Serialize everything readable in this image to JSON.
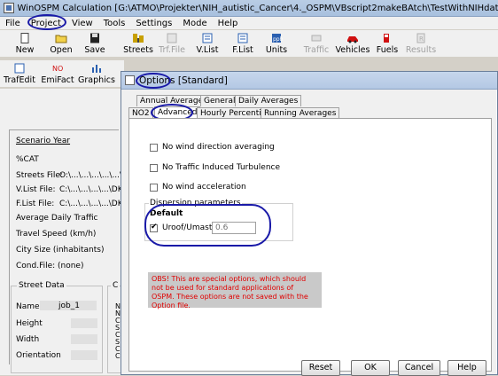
{
  "window": {
    "title": "WinOSPM Calculation [G:\\ATMO\\Projekter\\NIH_autistic_Cancer\\4._OSPM\\VBscript2makeBAtch\\TestWithNIHdata\\M..."
  },
  "menu": [
    "File",
    "Project",
    "View",
    "Tools",
    "Settings",
    "Mode",
    "Help"
  ],
  "toolbar": {
    "new": "New",
    "open": "Open",
    "save": "Save",
    "streets": "Streets",
    "trf_file": "Trf.File",
    "vlist": "V.List",
    "flist": "F.List",
    "units": "Units",
    "traffic": "Traffic",
    "vehicles": "Vehicles",
    "fuels": "Fuels",
    "results": "Results"
  },
  "toolbar2": {
    "trafedit": "TrafEdit",
    "emifact": "EmiFact",
    "graphics": "Graphics"
  },
  "left_panel": {
    "scenario_year": "Scenario Year",
    "cat": "%CAT",
    "streets_file_label": "Streets File:",
    "streets_file_value": "O:\\...\\...\\...\\...\\...\\",
    "vlist_file_label": "V.List File:",
    "vlist_file_value": "C:\\...\\...\\...\\...\\DK\\",
    "flist_file_label": "F.List File:",
    "flist_file_value": "C:\\...\\...\\...\\...\\DK\\",
    "avg_daily_traffic": "Average Daily Traffic",
    "travel_speed": "Travel Speed (km/h)",
    "city_size": "City Size (inhabitants)",
    "cond_file_label": "Cond.File:",
    "cond_file_value": "(none)",
    "street_data_title": "Street Data",
    "name_label": "Name",
    "name_value": "job_1",
    "height_label": "Height",
    "width_label": "Width",
    "orientation_label": "Orientation",
    "second_group_title": "C",
    "second_group_rows": [
      "N",
      "N",
      "C",
      "S",
      "C",
      "S",
      "C",
      "C"
    ]
  },
  "dialog": {
    "title": "Options [Standard]",
    "tabs_row1": [
      "Annual Averages",
      "General",
      "Daily Averages"
    ],
    "tabs_row2": [
      "NO2",
      "Advanced",
      "Hourly Percentiles",
      "Running Averages"
    ],
    "options": {
      "no_wind_dir_avg": {
        "label": "No wind direction averaging",
        "checked": false
      },
      "no_traffic_turb": {
        "label": "No Traffic Induced Turbulence",
        "checked": false
      },
      "no_wind_accel": {
        "label": "No wind acceleration",
        "checked": false
      }
    },
    "dispersion": {
      "title": "Dispersion parameters",
      "default_label": "Default",
      "uroof_label": "Uroof/Umast",
      "uroof_checked": true,
      "uroof_value": "0.6"
    },
    "warning": "OBS! This are special options, which should not be used for standard applications of OSPM. These options are not saved with the Option file.",
    "buttons": {
      "reset": "Reset",
      "ok": "OK",
      "cancel": "Cancel",
      "help": "Help"
    }
  },
  "colors": {
    "warning_text": "#e00000",
    "annotation": "#1a1aa8",
    "title_bar": "#b4c8e4"
  }
}
